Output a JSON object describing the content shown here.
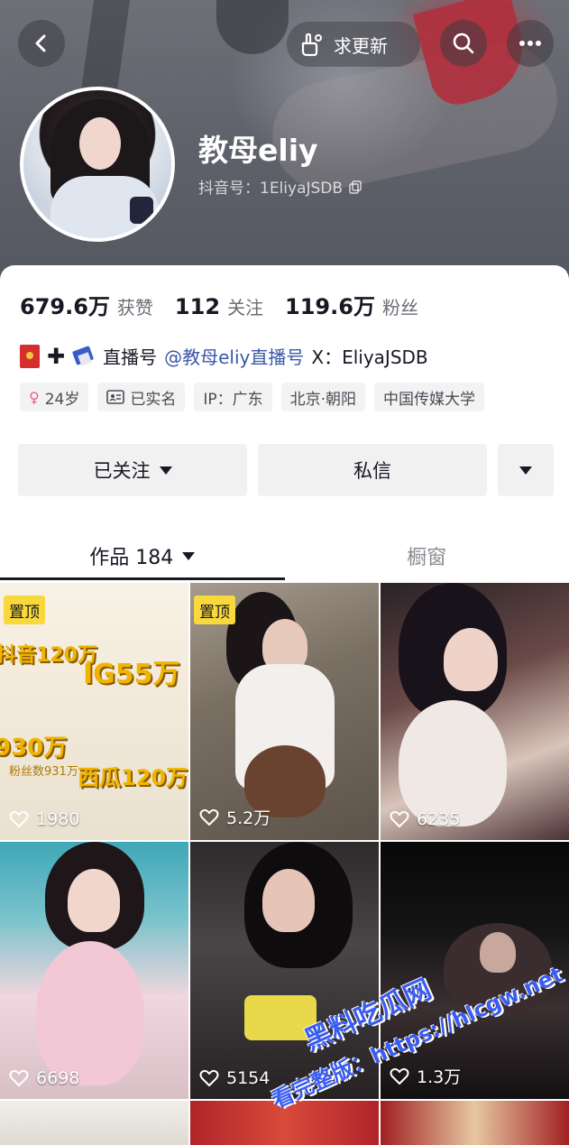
{
  "header": {
    "update_label": "求更新",
    "name": "教母eliy",
    "douyin_id": "抖音号：1EliyaJSDB"
  },
  "stats": {
    "likes_num": "679.6万",
    "likes_label": "获赞",
    "following_num": "112",
    "following_label": "关注",
    "fans_num": "119.6万",
    "fans_label": "粉丝"
  },
  "bio": {
    "prefix": "直播号",
    "mention": "@教母eliy直播号",
    "suffix": "X：EliyaJSDB"
  },
  "tags": [
    "24岁",
    "已实名",
    "IP：广东",
    "北京·朝阳",
    "中国传媒大学"
  ],
  "actions": {
    "follow_label": "已关注",
    "message_label": "私信"
  },
  "tabs": {
    "works_label": "作品 184",
    "shop_label": "橱窗"
  },
  "videos": [
    {
      "likes": "1980",
      "pinned": "置顶"
    },
    {
      "likes": "5.2万",
      "pinned": "置顶"
    },
    {
      "likes": "6235"
    },
    {
      "likes": "6698"
    },
    {
      "likes": "5154"
    },
    {
      "likes": "1.3万"
    }
  ],
  "thumb1_text": {
    "a": "抖音120万",
    "b": "IG55万",
    "c": "930万",
    "d": "西瓜120万",
    "e": "粉丝数931万"
  },
  "watermark": {
    "line1": "黑料吃瓜网",
    "line2": "看完整版：https://hlcgw.net"
  },
  "colors": {
    "accent_pin": "#f8d83a",
    "mention": "#3a57a8"
  }
}
